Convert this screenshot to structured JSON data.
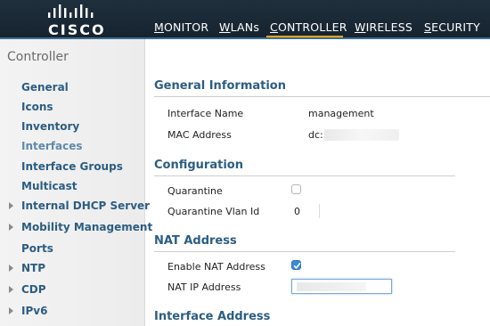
{
  "header": {
    "logo_text": "CISCO",
    "nav": [
      {
        "mnemonic": "M",
        "rest": "ONITOR"
      },
      {
        "mnemonic": "W",
        "rest": "LANs"
      },
      {
        "mnemonic": "C",
        "rest": "ONTROLLER"
      },
      {
        "mnemonic": "W",
        "rest": "IRELESS"
      },
      {
        "mnemonic": "S",
        "rest": "ECURITY"
      }
    ],
    "active_nav": "CONTROLLER",
    "accent_color": "#f0a21a"
  },
  "sidebar": {
    "title": "Controller",
    "items": [
      {
        "label": "General",
        "expandable": false,
        "active": false
      },
      {
        "label": "Icons",
        "expandable": false,
        "active": false
      },
      {
        "label": "Inventory",
        "expandable": false,
        "active": false
      },
      {
        "label": "Interfaces",
        "expandable": false,
        "active": true
      },
      {
        "label": "Interface Groups",
        "expandable": false,
        "active": false
      },
      {
        "label": "Multicast",
        "expandable": false,
        "active": false
      },
      {
        "label": "Internal DHCP Server",
        "expandable": true,
        "active": false
      },
      {
        "label": "Mobility Management",
        "expandable": true,
        "active": false
      },
      {
        "label": "Ports",
        "expandable": false,
        "active": false
      },
      {
        "label": "NTP",
        "expandable": true,
        "active": false
      },
      {
        "label": "CDP",
        "expandable": true,
        "active": false
      },
      {
        "label": "IPv6",
        "expandable": true,
        "active": false
      }
    ]
  },
  "main": {
    "general": {
      "title": "General Information",
      "interface_name_label": "Interface Name",
      "interface_name_value": "management",
      "mac_label": "MAC Address",
      "mac_value_prefix": "dc:"
    },
    "configuration": {
      "title": "Configuration",
      "quarantine_label": "Quarantine",
      "quarantine_checked": false,
      "vlan_label": "Quarantine Vlan Id",
      "vlan_value": "0"
    },
    "nat": {
      "title": "NAT Address",
      "enable_label": "Enable NAT Address",
      "enable_checked": true,
      "ip_label": "NAT IP Address",
      "ip_value": ""
    },
    "interface_address": {
      "title": "Interface Address"
    }
  }
}
